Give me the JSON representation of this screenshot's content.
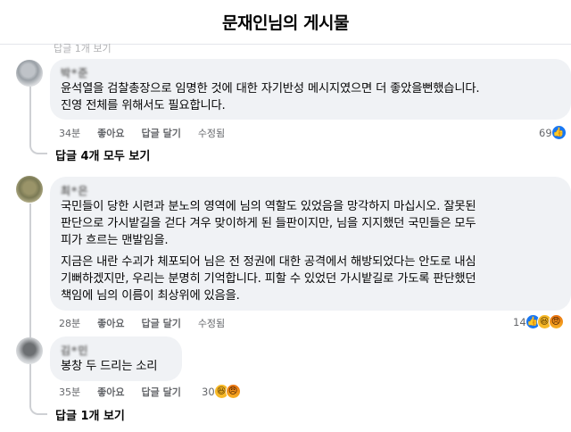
{
  "header": {
    "title": "문재인님의 게시물"
  },
  "cut_label": "답글 1개 보기",
  "comments": [
    {
      "author": "박*준",
      "lines": [
        "윤석열을 검찰총장으로 임명한 것에 대한 자기반성 메시지였으면 더 좋았을뻔했습니다.",
        "진영 전체를 위해서도 필요합니다."
      ],
      "time": "34분",
      "like": "좋아요",
      "reply": "답글 달기",
      "edited": "수정됨",
      "reaction_count": "69",
      "reactions": [
        "like"
      ],
      "view_replies": "답글 4개 모두 보기"
    },
    {
      "author": "최*은",
      "para1": [
        "국민들이 당한 시련과 분노의 영역에 님의 역할도 있었음을 망각하지 마십시오. 잘못된",
        "판단으로 가시밭길을 걷다 겨우 맞이하게 된 들판이지만, 님을 지지했던 국민들은 모두",
        "피가 흐르는 맨발임을."
      ],
      "para2": [
        "지금은 내란 수괴가 체포되어 님은 전 정권에 대한 공격에서 해방되었다는 안도로 내심",
        "기뻐하겠지만, 우리는 분명히 기억합니다. 피할 수 있었던 가시밭길로 가도록 판단했던",
        "책임에 님의 이름이 최상위에 있음을."
      ],
      "time": "28분",
      "like": "좋아요",
      "reply": "답글 달기",
      "edited": "수정됨",
      "reaction_count": "14",
      "reactions": [
        "like",
        "haha",
        "angry"
      ]
    },
    {
      "author": "김*민",
      "lines": [
        "봉창 두 드리는 소리"
      ],
      "time": "35분",
      "like": "좋아요",
      "reply": "답글 달기",
      "reaction_count": "30",
      "reactions": [
        "haha",
        "angry"
      ],
      "view_replies": "답글 1개 보기"
    }
  ]
}
